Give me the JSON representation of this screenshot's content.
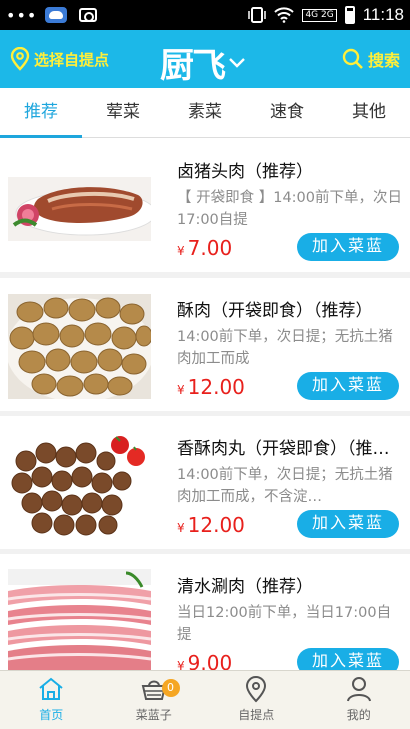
{
  "status_bar": {
    "dots": "•••",
    "time": "11:18",
    "network": "4G 2G"
  },
  "header": {
    "location_label": "选择自提点",
    "logo_text": "厨飞",
    "search_label": "搜索"
  },
  "tabs": [
    {
      "label": "推荐",
      "active": true
    },
    {
      "label": "荤菜"
    },
    {
      "label": "素菜"
    },
    {
      "label": "速食"
    },
    {
      "label": "其他"
    }
  ],
  "add_button_label": "加入菜蓝",
  "currency": "¥",
  "items": [
    {
      "name": "卤猪头肉（推荐）",
      "desc": "【 开袋即食 】14:00前下单，次日17:00自提",
      "price": "7.00",
      "image": "braised-pork-head-image"
    },
    {
      "name": "酥肉（开袋即食）（推荐）",
      "desc": "14:00前下单，次日提；无抗土猪肉加工而成",
      "price": "12.00",
      "image": "crispy-pork-image"
    },
    {
      "name": "香酥肉丸（开袋即食）（推…",
      "desc": "14:00前下单，次日提；无抗土猪肉加工而成，不含淀…",
      "price": "12.00",
      "image": "meatballs-image"
    },
    {
      "name": "清水涮肉（推荐）",
      "desc": "当日12:00前下单，当日17:00自提",
      "price": "9.00",
      "image": "sliced-pork-image"
    }
  ],
  "bottom_nav": [
    {
      "label": "首页",
      "icon": "home-icon",
      "active": true
    },
    {
      "label": "菜蓝子",
      "icon": "basket-icon",
      "badge": "0"
    },
    {
      "label": "自提点",
      "icon": "location-pin-icon"
    },
    {
      "label": "我的",
      "icon": "user-icon"
    }
  ],
  "colors": {
    "brand": "#1cb8e8",
    "header_text": "#ffef3a",
    "price": "#e8201c",
    "badge": "#f5a623"
  }
}
